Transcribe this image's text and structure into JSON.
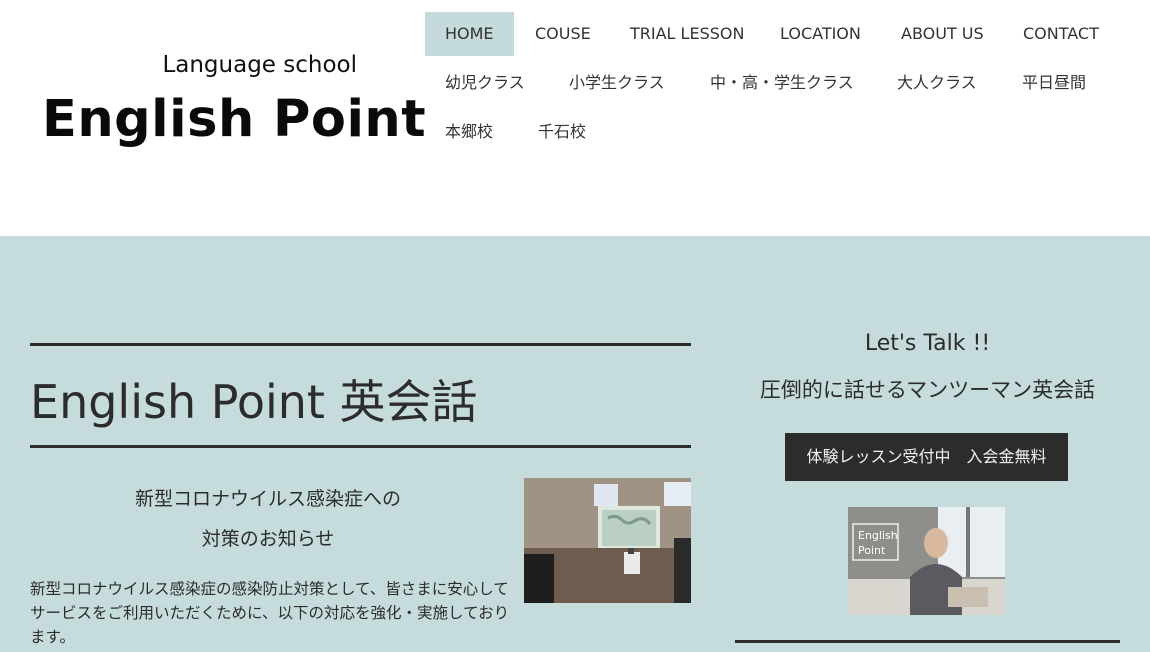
{
  "logo": {
    "subtitle": "Language school",
    "name": "English Point"
  },
  "nav": {
    "row1": [
      {
        "label": "HOME",
        "active": true
      },
      {
        "label": "COUSE"
      },
      {
        "label": "TRIAL LESSON"
      },
      {
        "label": "LOCATION"
      },
      {
        "label": "ABOUT US"
      },
      {
        "label": "CONTACT"
      }
    ],
    "row2": [
      {
        "label": "幼児クラス"
      },
      {
        "label": "小学生クラス"
      },
      {
        "label": "中・高・学生クラス"
      },
      {
        "label": "大人クラス"
      },
      {
        "label": "平日昼間"
      }
    ],
    "row3": [
      {
        "label": "本郷校"
      },
      {
        "label": "千石校"
      }
    ]
  },
  "main": {
    "title": "English Point 英会話",
    "notice_title_line1": "新型コロナウイルス感染症への",
    "notice_title_line2": "対策のお知らせ",
    "notice_body": "新型コロナウイルス感染症の感染防止対策として、皆さまに安心してサービスをご利用いただくために、以下の対応を強化・実施しております。"
  },
  "side": {
    "tagline_en": "Let's Talk !!",
    "tagline_ja": "圧倒的に話せるマンツーマン英会話",
    "cta_label": "体験レッスン受付中　入会金無料",
    "photo_badge_line1": "English",
    "photo_badge_line2": "Point"
  },
  "colors": {
    "band": "#c6dcdc",
    "nav_active": "#c5dbdb",
    "text": "#2c2c2c",
    "cta_bg": "#2c2c2c"
  }
}
